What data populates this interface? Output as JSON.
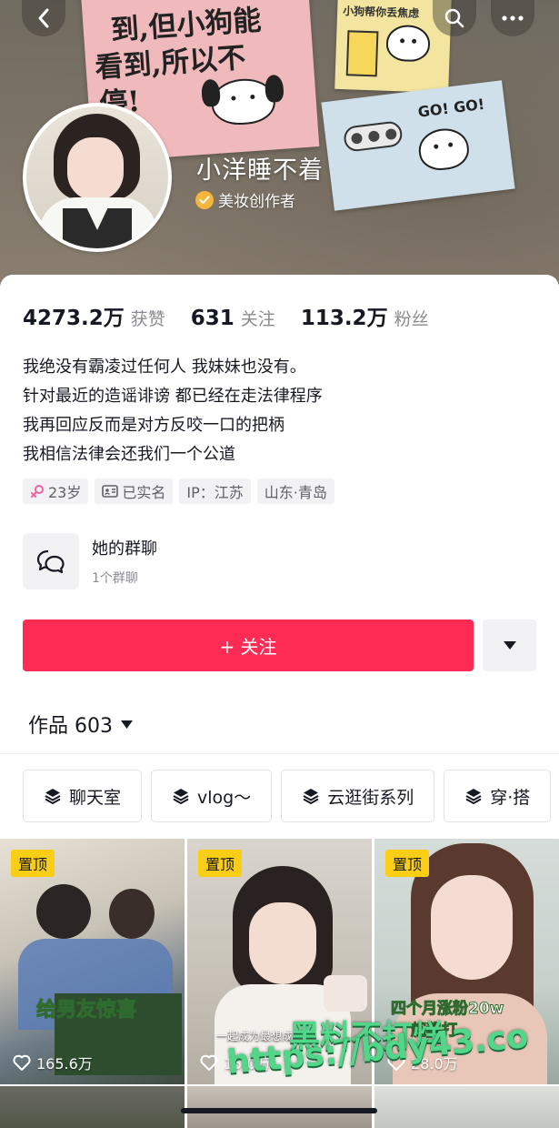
{
  "cover": {
    "note_lines": [
      "到,但小狗能",
      "看到,所以不",
      "停!"
    ],
    "yellow_note_text": "小狗帮你丢焦虑",
    "blue_note_text": "GO! GO!"
  },
  "profile": {
    "nickname": "小洋睡不着",
    "creator_label": "美妆创作者",
    "stats": [
      {
        "value": "4273.2万",
        "label": "获赞"
      },
      {
        "value": "631",
        "label": "关注"
      },
      {
        "value": "113.2万",
        "label": "粉丝"
      }
    ],
    "bio": [
      "我绝没有霸凌过任何人 我妹妹也没有。",
      "针对最近的造谣诽谤 都已经在走法律程序",
      "我再回应反而是对方反咬一口的把柄",
      "我相信法律会还我们一个公道"
    ],
    "tags": {
      "age": "23岁",
      "verified": "已实名",
      "ip": "IP：江苏",
      "location": "山东·青岛"
    }
  },
  "group_chat": {
    "title": "她的群聊",
    "subtitle": "1个群聊"
  },
  "actions": {
    "follow_label": "+ 关注"
  },
  "works": {
    "tab_label": "作品 603",
    "collections": [
      "聊天室",
      "vlog～",
      "云逛街系列",
      "穿·搭"
    ],
    "videos": [
      {
        "pinned": "置顶",
        "caption": "给男友惊喜",
        "likes": "165.6万"
      },
      {
        "pinned": "置顶",
        "caption": "一起成为最想成",
        "likes": "15.0万"
      },
      {
        "pinned": "置顶",
        "caption": "四个月涨粉20w",
        "caption2": "超稳打",
        "likes": "28.0万"
      }
    ]
  },
  "watermark": {
    "line1": "黑料不打烊",
    "line2": "https://bdy43.co"
  },
  "colors": {
    "accent": "#fe2c55",
    "pin": "#face15",
    "creator_badge": "#f4b73b"
  }
}
